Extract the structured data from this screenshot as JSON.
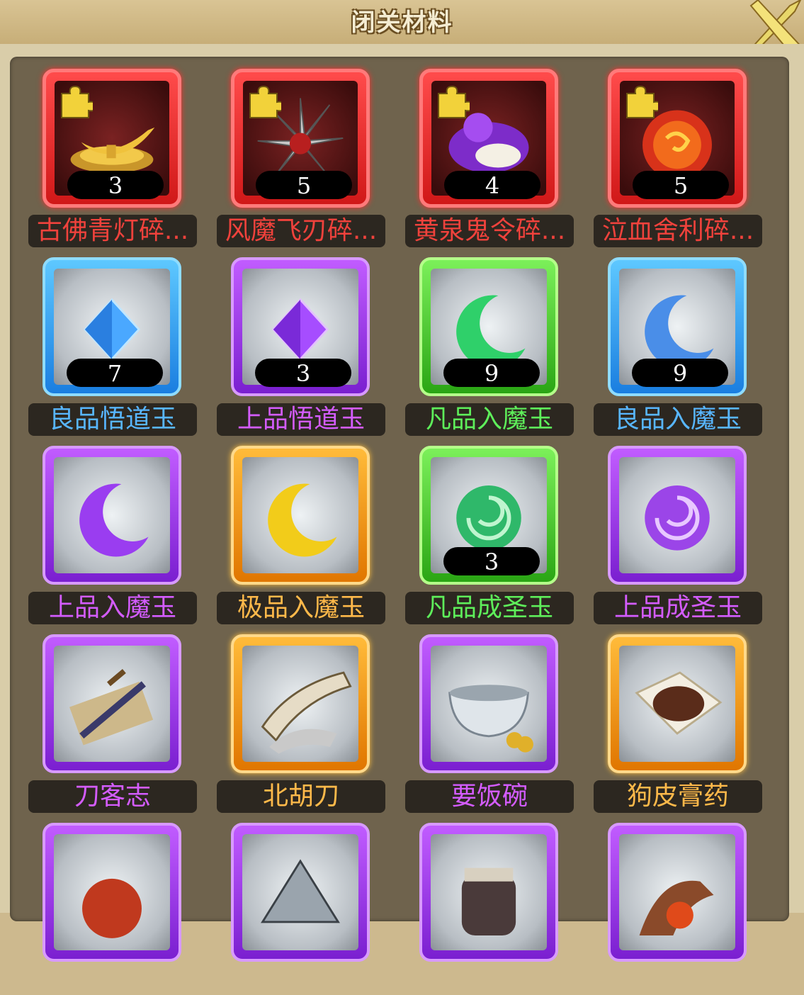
{
  "title": "闭关材料",
  "items": [
    {
      "name": "古佛青灯碎...",
      "count": "3",
      "rarity": "red",
      "fragment": true,
      "icon": "golden-lamp-icon"
    },
    {
      "name": "风魔飞刃碎...",
      "count": "5",
      "rarity": "red",
      "fragment": true,
      "icon": "flying-blade-icon"
    },
    {
      "name": "黄泉鬼令碎...",
      "count": "4",
      "rarity": "red",
      "fragment": true,
      "icon": "ghost-token-icon"
    },
    {
      "name": "泣血舍利碎...",
      "count": "5",
      "rarity": "red",
      "fragment": true,
      "icon": "blood-relic-icon"
    },
    {
      "name": "良品悟道玉",
      "count": "7",
      "rarity": "blue",
      "fragment": false,
      "icon": "blue-crystal-icon"
    },
    {
      "name": "上品悟道玉",
      "count": "3",
      "rarity": "purple",
      "fragment": false,
      "icon": "purple-crystal-icon"
    },
    {
      "name": "凡品入魔玉",
      "count": "9",
      "rarity": "green",
      "fragment": false,
      "icon": "green-crescent-icon"
    },
    {
      "name": "良品入魔玉",
      "count": "9",
      "rarity": "blue",
      "fragment": false,
      "icon": "blue-crescent-icon"
    },
    {
      "name": "上品入魔玉",
      "count": "",
      "rarity": "purple",
      "fragment": false,
      "icon": "purple-crescent-icon"
    },
    {
      "name": "极品入魔玉",
      "count": "",
      "rarity": "orange",
      "fragment": false,
      "icon": "gold-crescent-icon"
    },
    {
      "name": "凡品成圣玉",
      "count": "3",
      "rarity": "green",
      "fragment": false,
      "icon": "green-swirl-icon"
    },
    {
      "name": "上品成圣玉",
      "count": "",
      "rarity": "purple",
      "fragment": false,
      "icon": "purple-swirl-icon"
    },
    {
      "name": "刀客志",
      "count": "",
      "rarity": "purple",
      "fragment": false,
      "icon": "sword-book-icon"
    },
    {
      "name": "北胡刀",
      "count": "",
      "rarity": "orange",
      "fragment": false,
      "icon": "horn-blade-icon"
    },
    {
      "name": "要饭碗",
      "count": "",
      "rarity": "purple",
      "fragment": false,
      "icon": "beggar-bowl-icon"
    },
    {
      "name": "狗皮膏药",
      "count": "",
      "rarity": "orange",
      "fragment": false,
      "icon": "plaster-icon"
    },
    {
      "name": "",
      "count": "",
      "rarity": "purple",
      "fragment": false,
      "icon": "red-orb-icon"
    },
    {
      "name": "",
      "count": "",
      "rarity": "purple",
      "fragment": false,
      "icon": "steel-fan-icon"
    },
    {
      "name": "",
      "count": "",
      "rarity": "purple",
      "fragment": false,
      "icon": "drum-pot-icon"
    },
    {
      "name": "",
      "count": "",
      "rarity": "purple",
      "fragment": false,
      "icon": "demon-claw-icon"
    }
  ],
  "colors": {
    "red": "#f0423c",
    "blue": "#58b6ff",
    "purple": "#d45cff",
    "green": "#5eee5a",
    "orange": "#ffb94a"
  }
}
